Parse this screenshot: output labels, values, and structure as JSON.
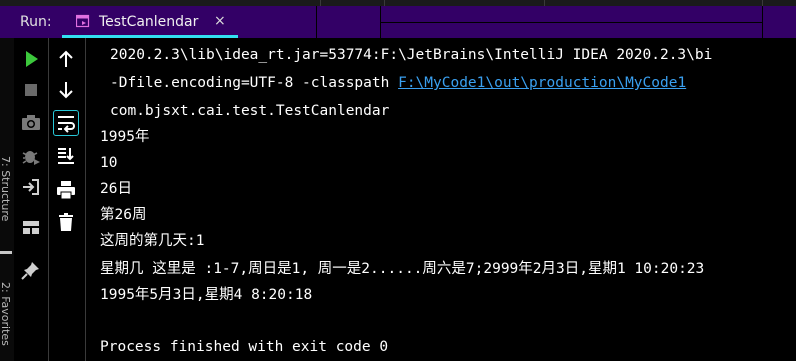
{
  "run_panel": {
    "label": "Run:",
    "tab": {
      "title": "TestCanlendar",
      "close_glyph": "×"
    }
  },
  "side_tabs": {
    "structure": "7: Structure",
    "favorites": "2: Favorites"
  },
  "toolbar_primary": [
    "run-icon",
    "stop-icon",
    "camera-icon",
    "debug-bug-icon",
    "login-icon",
    "layout-icon",
    "pin-icon"
  ],
  "toolbar_secondary": [
    "arrow-up-icon",
    "arrow-down-icon",
    "soft-wrap-icon",
    "scroll-to-end-icon",
    "print-icon",
    "trash-icon"
  ],
  "console": {
    "cmd_line1": "2020.2.3\\lib\\idea_rt.jar=53774:F:\\JetBrains\\IntelliJ IDEA 2020.2.3\\bi",
    "cmd_line2_prefix": "-Dfile.encoding=UTF-8 -classpath ",
    "cmd_line2_link": "F:\\MyCode1\\out\\production\\MyCode1",
    "cmd_line3": "com.bjsxt.cai.test.TestCanlendar",
    "output": [
      "1995年",
      "10",
      "26日",
      "第26周",
      "这周的第几天:1",
      "星期几 这里是 :1-7,周日是1, 周一是2......周六是7;2999年2月3日,星期1 10:20:23",
      "1995年5月3日,星期4 8:20:18"
    ],
    "exit_message": "Process finished with exit code 0"
  },
  "colors": {
    "tab_bar_bg": "#330066",
    "tab_underline": "#33e0f0",
    "run_green": "#3cc83c",
    "link": "#3aa0f0",
    "console_bg": "#000000",
    "console_text": "#ffffff"
  }
}
